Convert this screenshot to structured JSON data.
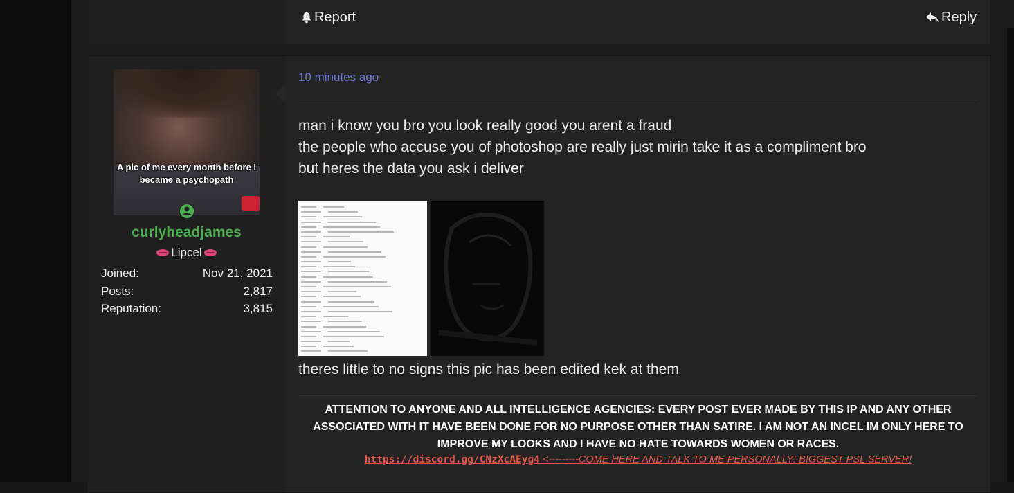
{
  "prev_post": {
    "report_label": "Report",
    "reply_label": "Reply"
  },
  "post": {
    "time": "10 minutes ago",
    "message_lines": [
      "man i know you bro you look really good you arent a fraud",
      "the people who accuse you of photoshop are really just mirin take it as a compliment bro",
      "but heres the data you ask i deliver"
    ],
    "message_after": "theres little to no signs this pic has been edited kek at them",
    "attachments": [
      "exif-data-screenshot",
      "error-level-analysis-image"
    ]
  },
  "user": {
    "username": "curlyheadjames",
    "title": "Lipcel",
    "avatar_caption": "A pic of me every month before I became a psychopath",
    "stats": [
      {
        "label": "Joined:",
        "value": "Nov 21, 2021"
      },
      {
        "label": "Posts:",
        "value": "2,817"
      },
      {
        "label": "Reputation:",
        "value": "3,815"
      }
    ],
    "username_color": "#4caf50"
  },
  "signature": {
    "notice": "ATTENTION TO ANYONE AND ALL INTELLIGENCE AGENCIES: EVERY POST EVER MADE BY THIS IP AND ANY OTHER ASSOCIATED WITH IT HAVE BEEN DONE FOR NO PURPOSE OTHER THAN SATIRE. I AM NOT AN INCEL IM ONLY HERE TO IMPROVE MY LOOKS AND I HAVE NO HATE TOWARDS WOMEN OR RACES.",
    "link": "https://discord.gg/CNzXcAEyg4",
    "link_suffix": " <---------COME HERE AND TALK TO ME PERSONALLY! BIGGEST PSL SERVER!"
  },
  "colors": {
    "time_link": "#6f73d9",
    "sig_link": "#e05a4a",
    "online": "#4caf50"
  }
}
